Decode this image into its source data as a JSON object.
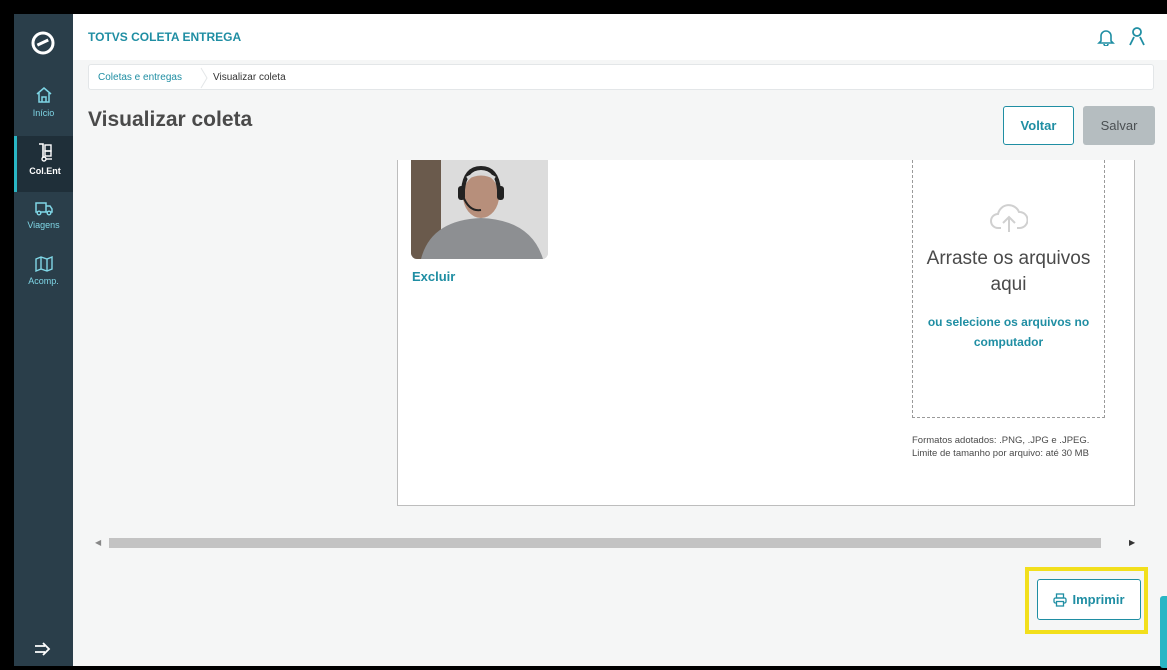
{
  "app": {
    "title": "TOTVS COLETA ENTREGA"
  },
  "sidebar": {
    "logo_icon": "totvs-logo-icon",
    "items": [
      {
        "label": "Início",
        "icon": "home-icon",
        "active": false
      },
      {
        "label": "Col.Ent",
        "icon": "hand-truck-icon",
        "active": true
      },
      {
        "label": "Viagens",
        "icon": "truck-icon",
        "active": false
      },
      {
        "label": "Acomp.",
        "icon": "map-icon",
        "active": false
      }
    ],
    "collapse_icon": "expand-menu-icon"
  },
  "header": {
    "notification_icon": "bell-icon",
    "user_icon": "user-icon"
  },
  "breadcrumb": {
    "items": [
      "Coletas e entregas",
      "Visualizar coleta"
    ]
  },
  "page": {
    "title": "Visualizar coleta",
    "back_label": "Voltar",
    "save_label": "Salvar"
  },
  "attachment": {
    "delete_label": "Excluir"
  },
  "upload": {
    "title": "Arraste os arquivos aqui",
    "link": "ou selecione os arquivos no computador",
    "formats": "Formatos adotados: .PNG, .JPG e .JPEG.",
    "size_limit": "Limite de tamanho por arquivo: até 30 MB"
  },
  "footer": {
    "print_label": "Imprimir"
  },
  "colors": {
    "sidebar_bg": "#2a3e4a",
    "accent": "#1f8ea3",
    "highlight": "#f2df1c",
    "disabled_button": "#b5bdc0"
  }
}
